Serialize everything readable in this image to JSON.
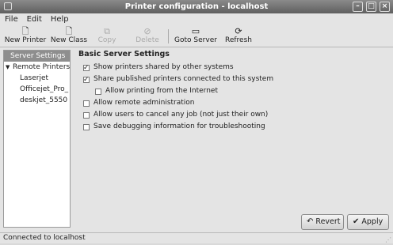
{
  "window": {
    "title": "Printer configuration - localhost"
  },
  "menu": {
    "items": [
      "File",
      "Edit",
      "Help"
    ]
  },
  "toolbar": {
    "buttons": [
      {
        "label": "New Printer",
        "icon": "new-printer-icon",
        "enabled": true
      },
      {
        "label": "New Class",
        "icon": "new-class-icon",
        "enabled": true
      },
      {
        "label": "Copy",
        "icon": "copy-icon",
        "enabled": false
      },
      {
        "label": "Delete",
        "icon": "delete-icon",
        "enabled": false
      },
      {
        "label": "Goto Server",
        "icon": "goto-server-icon",
        "enabled": true
      },
      {
        "label": "Refresh",
        "icon": "refresh-icon",
        "enabled": true
      }
    ]
  },
  "sidebar": {
    "selected": "Server Settings",
    "group": "Remote Printers",
    "printers": [
      "Laserjet",
      "Officejet_Pro_",
      "deskjet_5550"
    ]
  },
  "settings": {
    "title": "Basic Server Settings",
    "options": [
      {
        "label": "Show printers shared by other systems",
        "checked": true,
        "indent": false
      },
      {
        "label": "Share published printers connected to this system",
        "checked": true,
        "indent": false
      },
      {
        "label": "Allow printing from the Internet",
        "checked": false,
        "indent": true
      },
      {
        "label": "Allow remote administration",
        "checked": false,
        "indent": false
      },
      {
        "label": "Allow users to cancel any job (not just their own)",
        "checked": false,
        "indent": false
      },
      {
        "label": "Save debugging information for troubleshooting",
        "checked": false,
        "indent": false
      }
    ]
  },
  "buttons": {
    "revert": "Revert",
    "apply": "Apply"
  },
  "status": {
    "text": "Connected to localhost"
  }
}
